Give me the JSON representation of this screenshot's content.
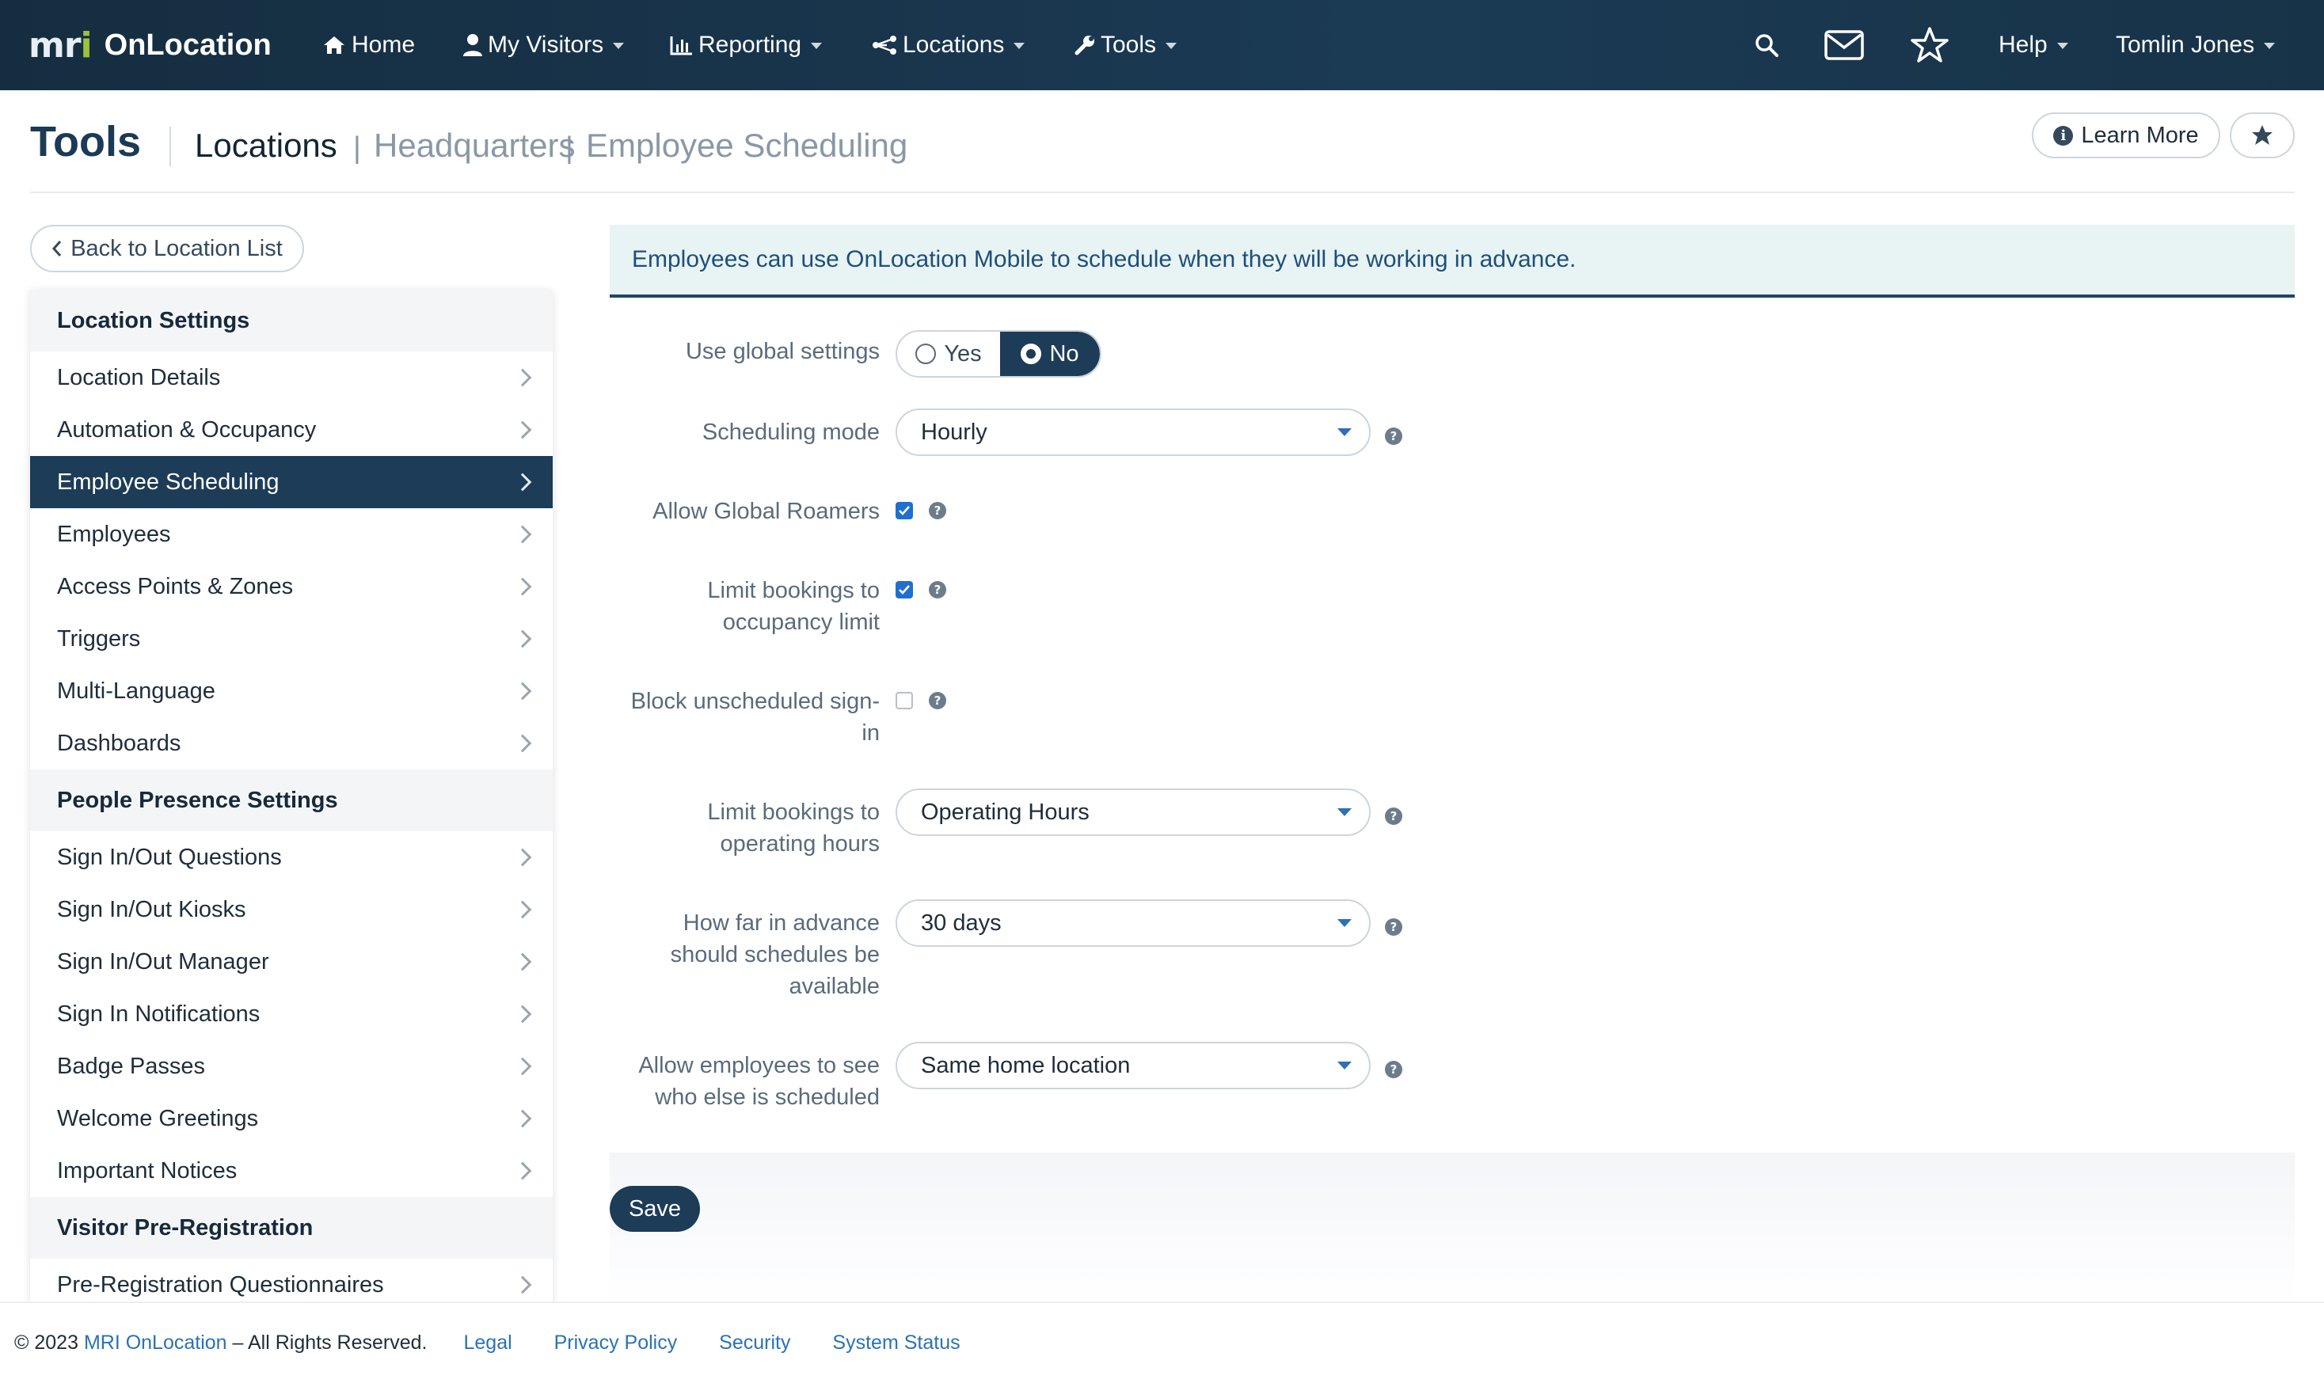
{
  "app": {
    "logo_mark": "mri",
    "logo_name": "OnLocation"
  },
  "nav": {
    "home": "Home",
    "my_visitors": "My Visitors",
    "reporting": "Reporting",
    "locations": "Locations",
    "tools": "Tools",
    "help": "Help",
    "user": "Tomlin Jones"
  },
  "header": {
    "title": "Tools",
    "crumb_main": "Locations",
    "crumb_sep": "|",
    "crumb_1": "Headquarters",
    "crumb_2": "Employee Scheduling",
    "learn_more": "Learn More"
  },
  "back_label": "Back to Location List",
  "sidebar": {
    "sections": [
      {
        "title": "Location Settings",
        "items": [
          "Location Details",
          "Automation & Occupancy",
          "Employee Scheduling",
          "Employees",
          "Access Points & Zones",
          "Triggers",
          "Multi-Language",
          "Dashboards"
        ]
      },
      {
        "title": "People Presence Settings",
        "items": [
          "Sign In/Out Questions",
          "Sign In/Out Kiosks",
          "Sign In/Out Manager",
          "Sign In Notifications",
          "Badge Passes",
          "Welcome Greetings",
          "Important Notices"
        ]
      },
      {
        "title": "Visitor Pre-Registration",
        "items": [
          "Pre-Registration Questionnaires"
        ]
      }
    ],
    "active": "Employee Scheduling"
  },
  "banner": "Employees can use OnLocation Mobile to schedule when they will be working in advance.",
  "form": {
    "global": {
      "label": "Use global settings",
      "yes": "Yes",
      "no": "No",
      "selected": "No"
    },
    "mode": {
      "label": "Scheduling mode",
      "value": "Hourly"
    },
    "roamers": {
      "label": "Allow Global Roamers",
      "checked": true
    },
    "occupancy": {
      "label_1": "Limit bookings to",
      "label_2": "occupancy limit",
      "checked": true
    },
    "block": {
      "label_1": "Block unscheduled sign-",
      "label_2": "in",
      "checked": false
    },
    "hours": {
      "label_1": "Limit bookings to",
      "label_2": "operating hours",
      "value": "Operating Hours"
    },
    "advance": {
      "label_1": "How far in advance",
      "label_2": "should schedules be",
      "label_3": "available",
      "value": "30 days"
    },
    "see": {
      "label_1": "Allow employees to see",
      "label_2": "who else is scheduled",
      "value": "Same home location"
    },
    "save": "Save"
  },
  "footer": {
    "copyright_prefix": "© 2023",
    "brand": "MRI OnLocation",
    "copyright_suffix": "– All Rights Reserved.",
    "legal": "Legal",
    "privacy": "Privacy Policy",
    "security": "Security",
    "status": "System Status"
  },
  "colors": {
    "nav_bg": "#1b3a54",
    "accent": "#1c3c58",
    "link": "#2a72b5",
    "logo_accent": "#9cc23c"
  }
}
